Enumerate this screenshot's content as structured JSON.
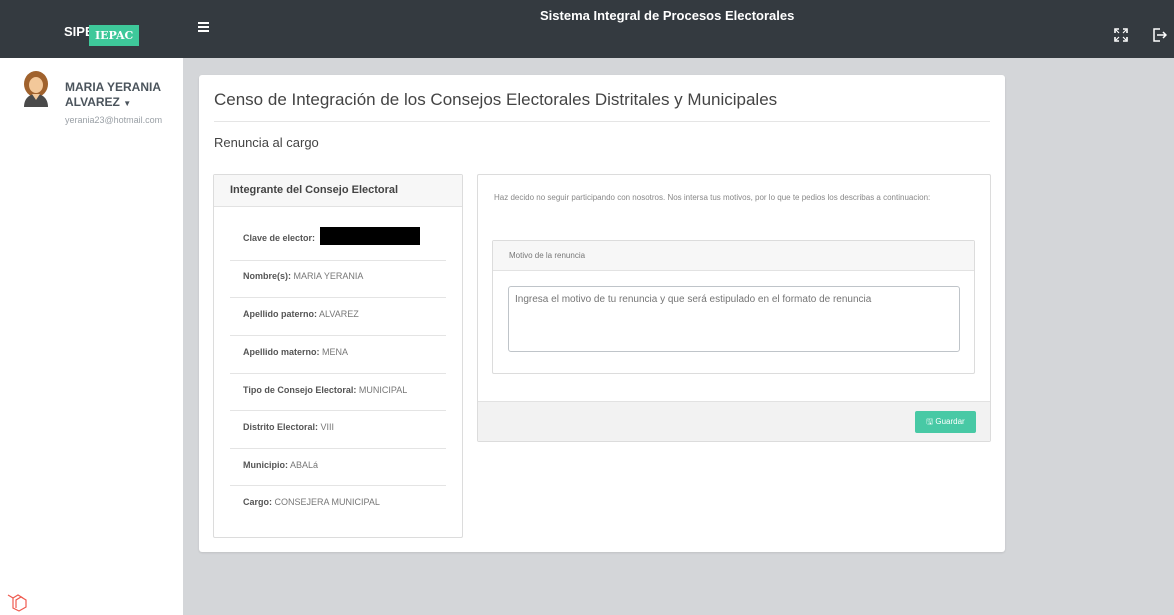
{
  "header": {
    "brand_name": "SIPE",
    "brand_badge": "IEPAC",
    "system_title": "Sistema Integral de Procesos Electorales",
    "menu_icon": "hamburger-icon",
    "fullscreen_icon": "expand-icon",
    "logout_icon": "logout-icon"
  },
  "user": {
    "name_line1": "MARIA YERANIA",
    "name_line2": "ALVAREZ",
    "email": "yerania23@hotmail.com",
    "dropdown_icon": "caret-down-icon"
  },
  "page": {
    "title": "Censo de Integración de los Consejos Electorales Distritales y Municipales",
    "subtitle": "Renuncia al cargo"
  },
  "member_card": {
    "header": "Integrante del Consejo Electoral",
    "rows": [
      {
        "label": "Clave de elector:",
        "value": ""
      },
      {
        "label": "Nombre(s):",
        "value": "MARIA YERANIA"
      },
      {
        "label": "Apellido paterno:",
        "value": "ALVAREZ"
      },
      {
        "label": "Apellido materno:",
        "value": "MENA"
      },
      {
        "label": "Tipo de Consejo Electoral:",
        "value": "MUNICIPAL"
      },
      {
        "label": "Distrito Electoral:",
        "value": "VIII"
      },
      {
        "label": "Municipio:",
        "value": "ABALá"
      },
      {
        "label": "Cargo:",
        "value": "CONSEJERA MUNICIPAL"
      }
    ]
  },
  "resignation": {
    "intro": "Haz decido no seguir participando con nosotros. Nos intersa tus motivos, por lo que te pedios los describas a continuacion:",
    "section_title": "Motivo de la renuncia",
    "textarea_placeholder": "Ingresa el motivo de tu renuncia y que será estipulado en el formato de renuncia",
    "save_label": "Guardar",
    "save_icon": "save-icon"
  },
  "colors": {
    "topbar": "#343a40",
    "accent": "#3ec89a",
    "button": "#48c9a5"
  }
}
